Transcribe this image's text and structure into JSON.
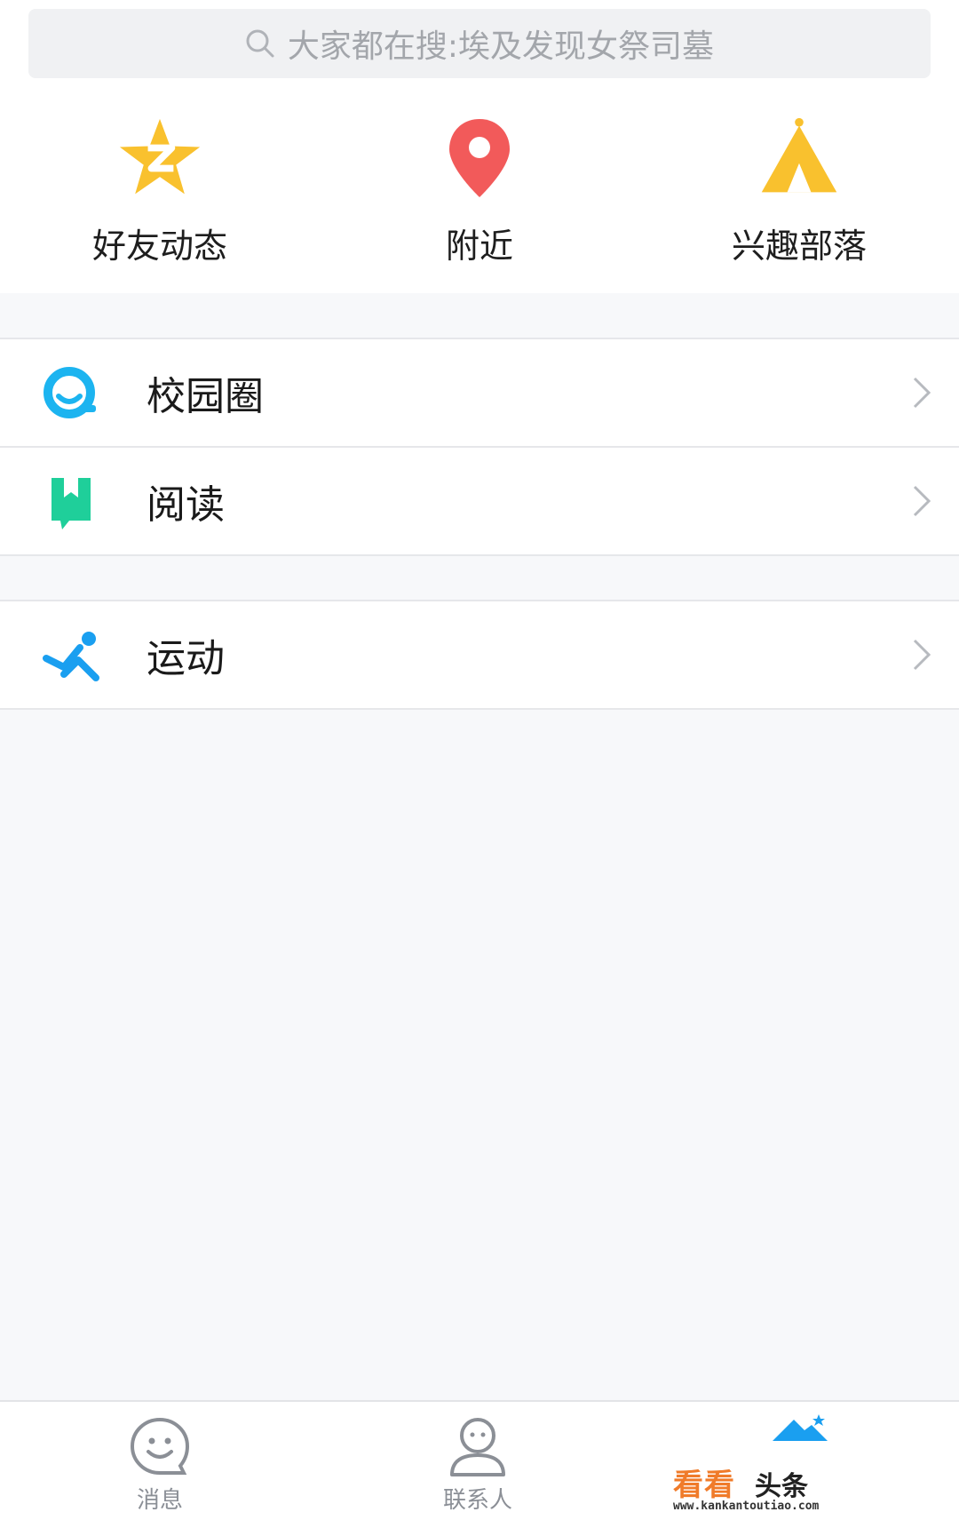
{
  "search": {
    "placeholder": "大家都在搜:埃及发现女祭司墓"
  },
  "quick_actions": [
    {
      "label": "好友动态",
      "icon": "qzone-star-icon",
      "color": "#f9c12e"
    },
    {
      "label": "附近",
      "icon": "location-pin-icon",
      "color": "#f25a5a"
    },
    {
      "label": "兴趣部落",
      "icon": "tent-icon",
      "color": "#f9c12e"
    }
  ],
  "menu_groups": [
    [
      {
        "label": "校园圈",
        "icon": "campus-circle-icon",
        "color": "#1cb4f0"
      },
      {
        "label": "阅读",
        "icon": "bookmark-book-icon",
        "color": "#1fcf9a"
      }
    ],
    [
      {
        "label": "运动",
        "icon": "running-figure-icon",
        "color": "#1a9ff0"
      }
    ]
  ],
  "tabbar": {
    "items": [
      {
        "label": "消息",
        "icon": "smiley-chat-icon"
      },
      {
        "label": "联系人",
        "icon": "person-icon"
      }
    ],
    "brand": {
      "name_colored": "看看",
      "name_dark": "头条",
      "url": "www.kankantoutiao.com"
    }
  }
}
